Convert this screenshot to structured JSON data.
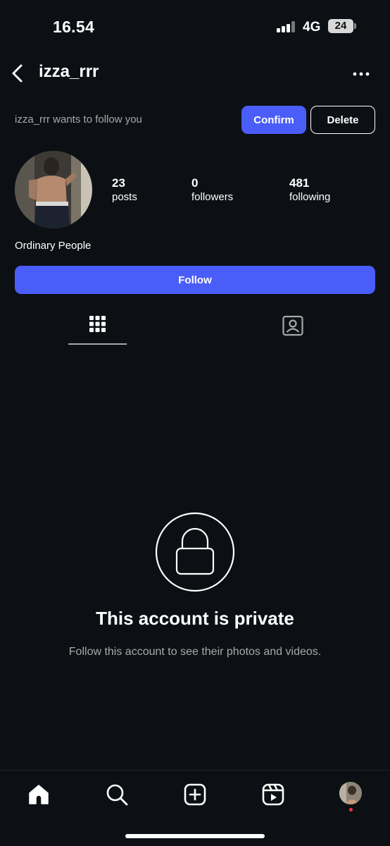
{
  "status_bar": {
    "time": "16.54",
    "network": "4G",
    "battery": "24"
  },
  "header": {
    "username": "izza_rrr",
    "back_icon": "chevron-left-icon",
    "more_icon": "more-horizontal-icon"
  },
  "follow_request": {
    "text": "izza_rrr wants to follow you",
    "confirm_label": "Confirm",
    "delete_label": "Delete"
  },
  "profile": {
    "stats": [
      {
        "value": "23",
        "label": "posts"
      },
      {
        "value": "0",
        "label": "followers"
      },
      {
        "value": "481",
        "label": "following"
      }
    ],
    "name": "Ordinary People",
    "follow_label": "Follow"
  },
  "tabs": [
    {
      "icon": "grid-icon",
      "active": true
    },
    {
      "icon": "tagged-person-icon",
      "active": false
    }
  ],
  "private": {
    "title": "This account is private",
    "subtitle": "Follow this account to see their photos and videos."
  },
  "bottom_nav": [
    {
      "icon": "home-icon"
    },
    {
      "icon": "search-icon"
    },
    {
      "icon": "create-post-icon"
    },
    {
      "icon": "reels-icon"
    },
    {
      "icon": "profile-avatar"
    }
  ],
  "colors": {
    "background": "#0c1014",
    "accent": "#4a5df9",
    "muted_text": "#a8a8a8",
    "notification_dot": "#ff3040"
  }
}
